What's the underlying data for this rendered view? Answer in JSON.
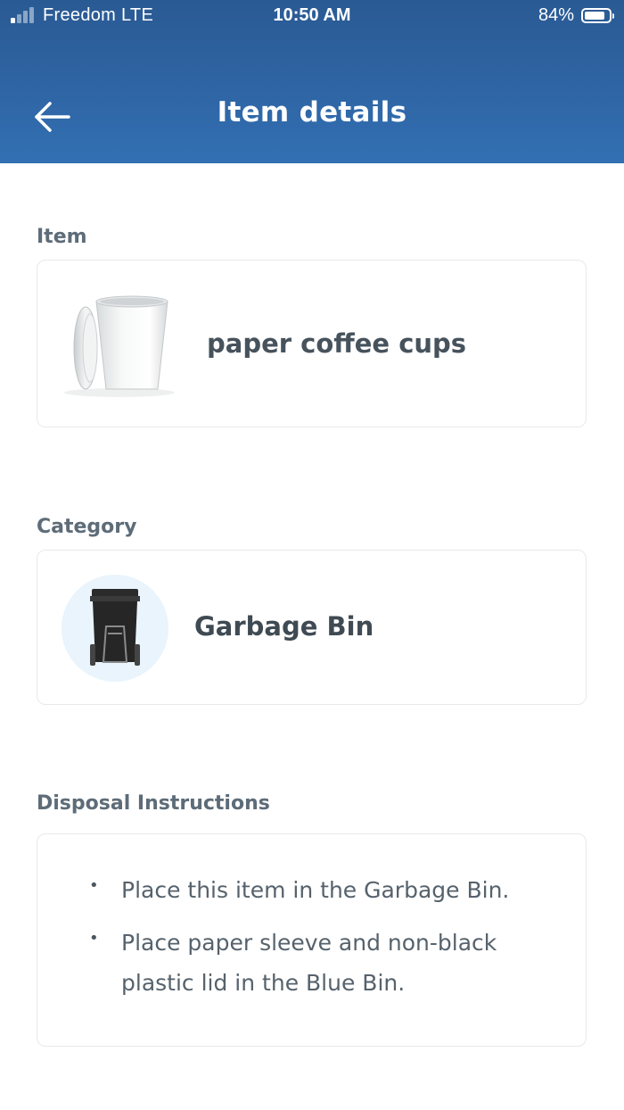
{
  "status_bar": {
    "carrier": "Freedom  LTE",
    "time": "10:50 AM",
    "battery_percent": "84%",
    "battery_level": 0.84,
    "signal_bars_on": 1,
    "signal_bars_total": 4
  },
  "header": {
    "title": "Item details",
    "back_icon": "arrow-left-icon",
    "color": "#2f66a6"
  },
  "item_section": {
    "label": "Item",
    "item_name": "paper coffee cups",
    "image": "paper-coffee-cup-icon"
  },
  "category_section": {
    "label": "Category",
    "category_name": "Garbage Bin",
    "icon": "garbage-bin-icon",
    "icon_background": "#e9f4fc"
  },
  "instructions_section": {
    "label": "Disposal Instructions",
    "items": [
      "Place this item in the Garbage Bin.",
      "Place paper sleeve and non-black plastic lid in the Blue Bin."
    ]
  }
}
